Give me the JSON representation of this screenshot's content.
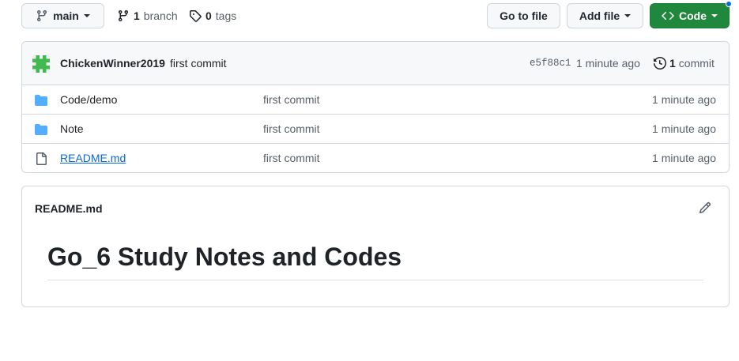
{
  "repo_nav": {
    "branch_selector": {
      "label": "main",
      "icon": "git-branch-icon"
    },
    "branches": {
      "count": "1",
      "label": "branch"
    },
    "tags": {
      "count": "0",
      "label": "tags"
    },
    "go_to_file": "Go to file",
    "add_file": "Add file",
    "code": "Code"
  },
  "latest_commit": {
    "author": "ChickenWinner2019",
    "message": "first commit",
    "hash": "e5f88c1",
    "time": "1 minute ago",
    "commit_count": "1",
    "commit_label": "commit"
  },
  "files": [
    {
      "name_prefix": "Code/",
      "name": "demo",
      "type": "directory",
      "message": "first commit",
      "time": "1 minute ago"
    },
    {
      "name_prefix": "",
      "name": "Note",
      "type": "directory",
      "message": "first commit",
      "time": "1 minute ago"
    },
    {
      "name_prefix": "",
      "name": "README.md",
      "type": "file",
      "message": "first commit",
      "time": "1 minute ago"
    }
  ],
  "readme": {
    "filename": "README.md",
    "heading": "Go_6 Study Notes and Codes"
  },
  "colors": {
    "primary_button": "#1f883d",
    "folder": "#54aeff",
    "link": "#0969da",
    "avatar": "#3fb950"
  }
}
